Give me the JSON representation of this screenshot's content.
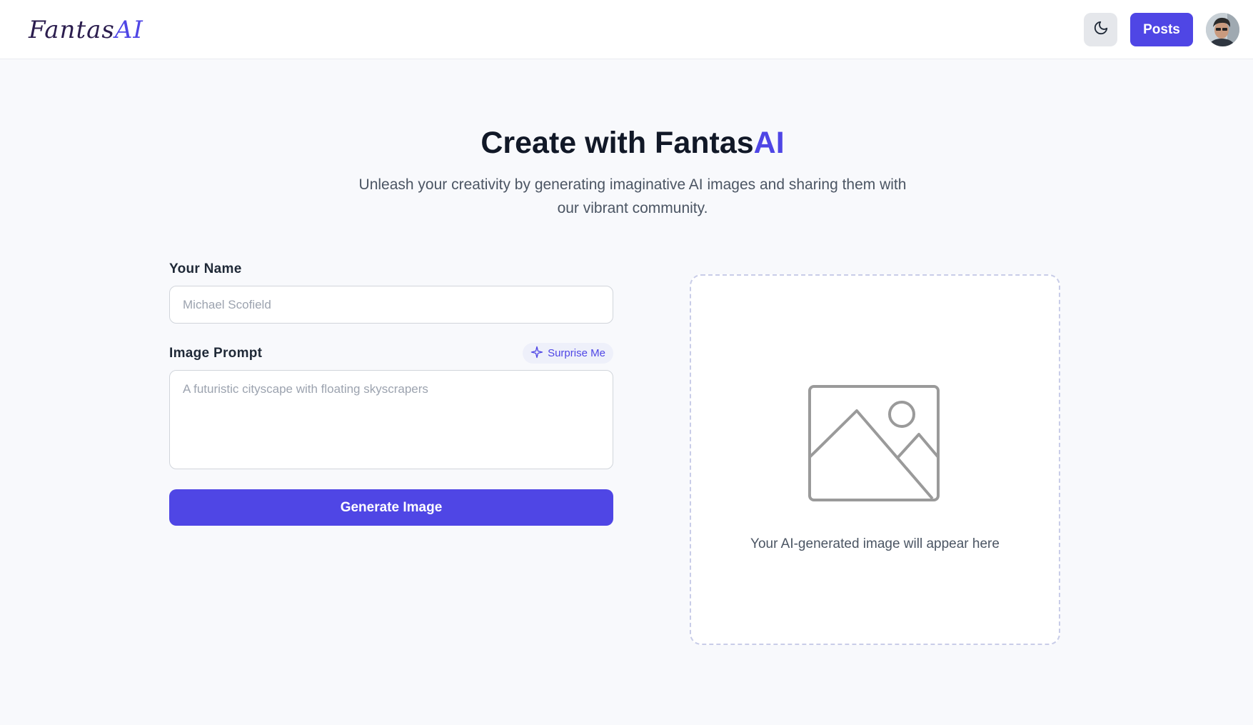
{
  "header": {
    "logo_main": "Fantas",
    "logo_accent": "AI",
    "theme_toggle_icon": "moon-icon",
    "posts_label": "Posts",
    "avatar_icon": "user-avatar"
  },
  "hero": {
    "title_main": "Create with Fantas",
    "title_accent": "AI",
    "subtitle": "Unleash your creativity by generating imaginative AI images and sharing them with our vibrant community."
  },
  "form": {
    "name_label": "Your Name",
    "name_value": "",
    "name_placeholder": "Michael Scofield",
    "prompt_label": "Image Prompt",
    "prompt_value": "",
    "prompt_placeholder": "A futuristic cityscape with floating skyscrapers",
    "surprise_label": "Surprise Me",
    "surprise_icon": "sparkle-icon",
    "generate_label": "Generate Image"
  },
  "preview": {
    "icon": "image-placeholder-icon",
    "text": "Your AI-generated image will appear here"
  },
  "colors": {
    "accent": "#4f46e5",
    "background": "#f8f9fc"
  }
}
